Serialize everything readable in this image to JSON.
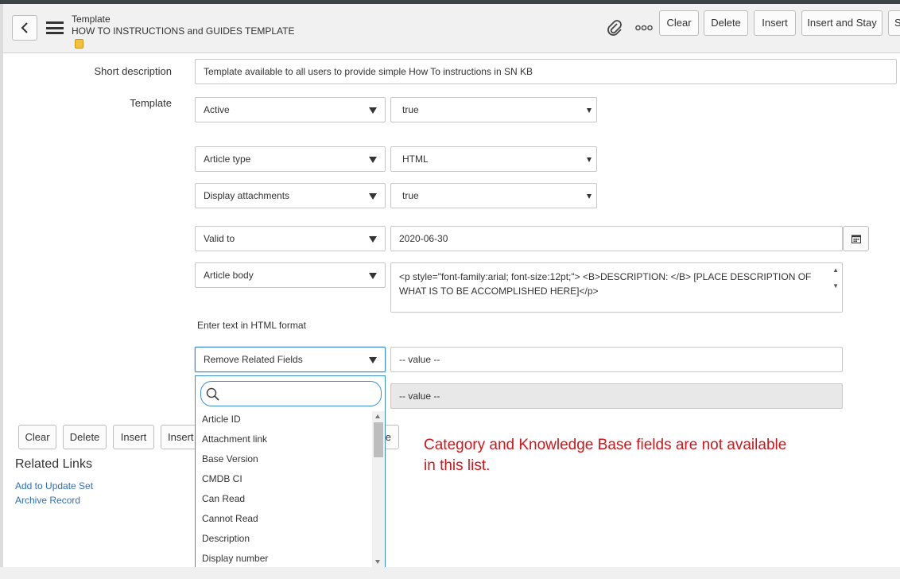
{
  "header": {
    "record_type": "Template",
    "record_name": "HOW TO INSTRUCTIONS and GUIDES TEMPLATE",
    "buttons": {
      "clear": "Clear",
      "delete": "Delete",
      "insert": "Insert",
      "insert_and_stay": "Insert and Stay",
      "overflow": "S"
    }
  },
  "form": {
    "short_description": {
      "label": "Short description",
      "value": "Template available to all users to provide simple How To instructions in SN KB"
    },
    "template_label": "Template",
    "rows": [
      {
        "field": "Active",
        "value": "true"
      },
      {
        "field": "Article type",
        "value": "HTML"
      },
      {
        "field": "Display attachments",
        "value": "true"
      },
      {
        "field": "Valid to",
        "value": "2020-06-30"
      },
      {
        "field": "Article body",
        "value": "<p style=\"font-family:arial; font-size:12pt;\"> <B>DESCRIPTION: </B>  [PLACE DESCRIPTION OF WHAT IS TO BE ACCOMPLISHED HERE]</p>"
      }
    ],
    "hint": "Enter text in HTML format",
    "remove_related": {
      "field": "Remove Related Fields",
      "value_placeholder": "-- value --",
      "value2_placeholder": "-- value --"
    }
  },
  "dropdown": {
    "search_value": "",
    "items": [
      "Article ID",
      "Attachment link",
      "Base Version",
      "CMDB CI",
      "Can Read",
      "Cannot Read",
      "Description",
      "Display number"
    ]
  },
  "bottom_buttons": {
    "clear": "Clear",
    "delete": "Delete",
    "insert": "Insert",
    "insert_and_stay_partial": "Insert",
    "hidden_partial": "e"
  },
  "related_links": {
    "title": "Related Links",
    "links": [
      "Add to Update Set",
      "Archive Record"
    ]
  },
  "annotation": {
    "line1": "Category and Knowledge Base fields are not available",
    "line2": "in this list.",
    "color": "#d0161b"
  }
}
